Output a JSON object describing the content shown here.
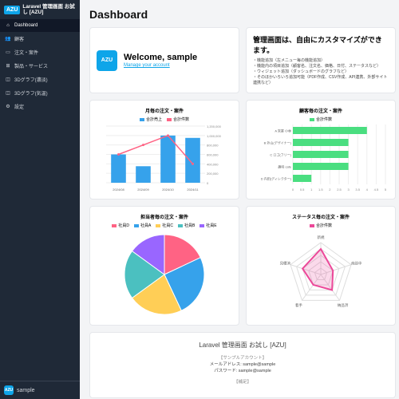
{
  "app": {
    "logo_text": "AZU",
    "title": "Laravel 管理画面\nお試し [AZU]"
  },
  "sidebar": {
    "items": [
      {
        "icon": "home",
        "label": "Dashboard",
        "active": true
      },
      {
        "icon": "users",
        "label": "顧客"
      },
      {
        "icon": "box",
        "label": "注文・案件"
      },
      {
        "icon": "tag",
        "label": "製品・サービス"
      },
      {
        "icon": "cube",
        "label": "3Dグラフ(濃淡)"
      },
      {
        "icon": "cube",
        "label": "3Dグラフ(気温)"
      },
      {
        "icon": "gear",
        "label": "設定"
      }
    ],
    "user": "sample"
  },
  "page_title": "Dashboard",
  "welcome": {
    "title": "Welcome, sample",
    "link": "Manage your account"
  },
  "notice": {
    "title": "管理画面は、自由にカスタマイズができます。",
    "lines": [
      "・機能追加（左メニュー毎の機能追加）",
      "・機能内の項目追加（顧客名、注文名、価格、日付、ステータスなど）",
      "・ウィジェット追加（ダッシュボードのグラフなど）",
      "・そのほかいろいろ追加可能（PDF作成、CSV作成、API連携、外部サイト連携など）"
    ]
  },
  "chart_data": [
    {
      "type": "bar+line",
      "title": "月毎の注文・案件",
      "series_labels": [
        "合計売上",
        "合計件数"
      ],
      "categories": [
        "2024/08",
        "2024/09",
        "2024/10",
        "2024/11"
      ],
      "bars": [
        600000,
        350000,
        1000000,
        950000
      ],
      "ylim_bar": [
        0,
        1200000
      ],
      "line": [
        3,
        4,
        5,
        2
      ],
      "ylim_line": [
        0,
        6
      ],
      "y_ticks_left": [
        0,
        200000,
        400000,
        600000,
        800000,
        1000000,
        1200000
      ],
      "colors": {
        "bar": "#36a2eb",
        "line": "#ff6384"
      }
    },
    {
      "type": "bar-horizontal",
      "title": "顧客毎の注文・案件",
      "series_labels": [
        "合計件数"
      ],
      "categories": [
        "A 営業 小林",
        "B 外山(デザイナー)",
        "C ロゴ(フリー)",
        "趣味 cafe",
        "D 内田(ディレクター)"
      ],
      "values": [
        4,
        3,
        3,
        3,
        1
      ],
      "xlim": [
        0,
        5
      ],
      "x_ticks": [
        0,
        0.5,
        1,
        1.5,
        2,
        2.5,
        3,
        3.5,
        4,
        4.5,
        5
      ],
      "color": "#4ade80"
    },
    {
      "type": "pie",
      "title": "担当者毎の注文・案件",
      "series": [
        {
          "name": "社員D",
          "value": 18,
          "color": "#ff6384"
        },
        {
          "name": "社員A",
          "value": 25,
          "color": "#36a2eb"
        },
        {
          "name": "社員C",
          "value": 22,
          "color": "#ffce56"
        },
        {
          "name": "社員B",
          "value": 20,
          "color": "#4bc0c0"
        },
        {
          "name": "社員E",
          "value": 15,
          "color": "#9966ff"
        }
      ]
    },
    {
      "type": "radar",
      "title": "ステータス毎の注文・案件",
      "series_labels": [
        "合計件数"
      ],
      "axes": [
        "新規",
        "商談中",
        "納品済",
        "着手",
        "見積済"
      ],
      "values": [
        4,
        2,
        3,
        2,
        3
      ],
      "max": 5,
      "color": "#ec4899"
    }
  ],
  "footer": {
    "title": "Laravel 管理画面 お試し [AZU]",
    "account_hd": "【サンプルアカウント】",
    "email": "メールアドレス: sample@sample",
    "password": "パスワード: sample@sample",
    "more": "【補足】"
  }
}
